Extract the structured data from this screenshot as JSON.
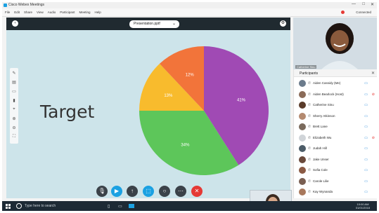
{
  "window": {
    "title": "Cisco Webex Meetings",
    "controls": [
      "—",
      "□",
      "✕"
    ]
  },
  "menu": {
    "items": [
      "File",
      "Edit",
      "Share",
      "View",
      "Audio",
      "Participant",
      "Meeting",
      "Help"
    ],
    "status": "Connected"
  },
  "share": {
    "file_select": "Presentation.pptf",
    "slide_text": "Target",
    "tools": [
      "pen-icon",
      "text-icon",
      "shapes-icon",
      "eraser-icon",
      "pointer-icon",
      "zoom-in-icon",
      "zoom-out-icon",
      "fit-icon"
    ]
  },
  "chart_data": {
    "type": "pie",
    "slices": [
      {
        "label": "41%",
        "value": 41,
        "color": "#a04ab4"
      },
      {
        "label": "34%",
        "value": 34,
        "color": "#5dc65a"
      },
      {
        "label": "13%",
        "value": 13,
        "color": "#f8bb2d"
      },
      {
        "label": "12%",
        "value": 12,
        "color": "#f2743a"
      }
    ]
  },
  "video": {
    "name": "Catherine Sinu"
  },
  "participants": {
    "title": "Participants",
    "items": [
      {
        "name": "Aiden Cassidy (Me)",
        "avatar_color": "#6b7b8c",
        "mic_muted": false
      },
      {
        "name": "Aiden Bearlock (Host)",
        "avatar_color": "#8a6b58",
        "mic_muted": true
      },
      {
        "name": "Catherine Sinu",
        "avatar_color": "#5a3b2a",
        "mic_muted": false
      },
      {
        "name": "Sherry Atkinson",
        "avatar_color": "#b48a70",
        "mic_muted": false
      },
      {
        "name": "Brett Lane",
        "avatar_color": "#7a6a5c",
        "mic_muted": false
      },
      {
        "name": "Elizabeth Wu",
        "avatar_color": "#d0d4d8",
        "mic_muted": true
      },
      {
        "name": "Judah Hill",
        "avatar_color": "#4c5c68",
        "mic_muted": false
      },
      {
        "name": "Jake Unser",
        "avatar_color": "#6a4a3c",
        "mic_muted": false
      },
      {
        "name": "Sofia Cole",
        "avatar_color": "#8b5a44",
        "mic_muted": false
      },
      {
        "name": "Carole Lilie",
        "avatar_color": "#7a5f52",
        "mic_muted": false
      },
      {
        "name": "Kay Wynanda",
        "avatar_color": "#a8785c",
        "mic_muted": false
      }
    ]
  },
  "controls": {
    "mute": "mic-icon",
    "video": "video-icon",
    "share": "share-icon",
    "record": "record-icon",
    "participants": "participants-icon",
    "more": "more-icon",
    "end": "end-call-icon"
  },
  "taskbar": {
    "search_placeholder": "Type here to search",
    "time": "10:00 AM",
    "date": "01/01/2018"
  },
  "colors": {
    "accent": "#1ba1e2",
    "end_call": "#e53935",
    "share_bg": "#cde4ea"
  }
}
